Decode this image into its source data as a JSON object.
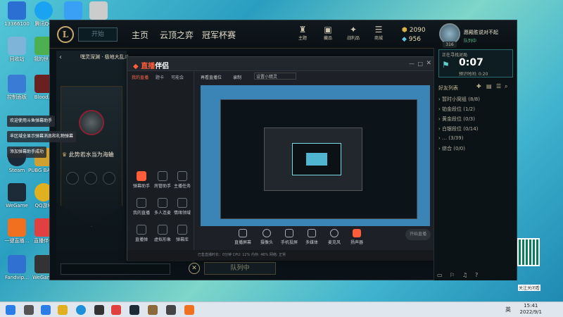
{
  "desktop_icons": [
    {
      "label": "13366100",
      "color": "#2a6fd1"
    },
    {
      "label": "腾讯QQ",
      "color": "#19a3f0"
    },
    {
      "label": "",
      "color": "#3aa0f5"
    },
    {
      "label": "回收站",
      "color": "#7db4d8"
    },
    {
      "label": "我的世界",
      "color": "#4caf50"
    },
    {
      "label": "控制面板",
      "color": "#3a7bd5"
    },
    {
      "label": "Blood...",
      "color": "#6a2020"
    },
    {
      "label": "Steam",
      "color": "#1b2838"
    },
    {
      "label": "PUBG BATTLEG...",
      "color": "#d0a030"
    },
    {
      "label": "WeGame",
      "color": "#1d2b38"
    },
    {
      "label": "QQ游戏",
      "color": "#e0b020"
    },
    {
      "label": "一键直播…",
      "color": "#f07020"
    },
    {
      "label": "直播伴侣",
      "color": "#e04040"
    },
    {
      "label": "Fandvip…",
      "color": "#3070d0"
    },
    {
      "label": "WeGame",
      "color": "#333"
    }
  ],
  "toasts": [
    "欢迎使用斗鱼弹幕助手",
    "丰区域全显示弹幕消息和礼物弹幕",
    "添加弹幕助手成功"
  ],
  "client": {
    "logo": "L",
    "play_label": "开始",
    "nav": [
      "主页",
      "云顶之弈",
      "冠军杯赛"
    ],
    "icons": [
      {
        "icon": "profile-icon",
        "glyph": "♜",
        "label": "主题"
      },
      {
        "icon": "collection-icon",
        "glyph": "▣",
        "label": "藏品"
      },
      {
        "icon": "tft-icon",
        "glyph": "✦",
        "label": "战利品"
      },
      {
        "icon": "store-icon",
        "glyph": "☰",
        "label": "商城"
      }
    ],
    "currency": {
      "be": "2090",
      "rp": "956"
    },
    "summoner": {
      "name": "愿殿胜说对不起",
      "status": "队列中",
      "level": "316"
    }
  },
  "lobby": {
    "title": "嘿灵深渊 · 极地大乱斗",
    "rank_text": "此势若水当为海蛐"
  },
  "friends": {
    "queue_label": "正在寻找对局",
    "timer": "0:07",
    "estimated": "预计时间: 0:20",
    "list_title": "好友列表",
    "groups": [
      "暂时小窝组 (8/8)",
      "铂金段位 (1/2)",
      "黄金段位 (0/3)",
      "白银段位 (0/14)",
      "… (3/39)",
      "综合 (0/0)"
    ]
  },
  "stream": {
    "logo_main": "直播",
    "logo_sub": "伴侣",
    "tabs": [
      "我的直播",
      "题卡",
      "可能会",
      "再看直播位",
      "录制",
      "设置小精灵"
    ],
    "title_placeholder": "英雄联盟 · 大师局分",
    "tools": [
      "弹幕助手",
      "房管助手",
      "主播任务",
      "我的直播",
      "多人连麦",
      "情绪领域",
      "直播弹",
      "虚拟形象",
      "弹幕库"
    ],
    "controls": [
      "直播屏幕",
      "摄像头",
      "手机投屏",
      "多媒体",
      "麦克风",
      "扬声器"
    ],
    "start_label": "开始直播",
    "status": "已售直播时长：0分钟   CPU: 12%   内存: 46%   网络: 正常"
  },
  "queue": {
    "button": "队列中",
    "cancel": "✕"
  },
  "taskbar": {
    "time": "15:41",
    "date": "2022/9/1",
    "lang": "英"
  },
  "qr_label": "关注关闭看"
}
